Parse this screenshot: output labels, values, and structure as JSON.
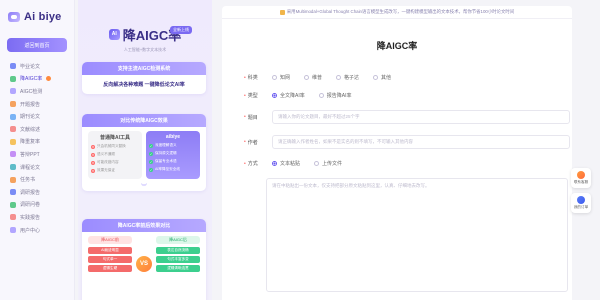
{
  "app": {
    "brand": "Ai biye"
  },
  "sidebar": {
    "home_button": "返回到首页",
    "items": [
      {
        "label": "毕业论文",
        "color": "#7a8cf5"
      },
      {
        "label": "降AIGC率",
        "color": "#5fc98b",
        "active": true,
        "badge": true
      },
      {
        "label": "AIGC检测",
        "color": "#b2a6ff"
      },
      {
        "label": "开题报告",
        "color": "#f5a25f"
      },
      {
        "label": "期刊论文",
        "color": "#7ab3f5"
      },
      {
        "label": "文献综述",
        "color": "#f58f8f"
      },
      {
        "label": "降重复率",
        "color": "#f5c25f"
      },
      {
        "label": "答辩PPT",
        "color": "#c48ff5"
      },
      {
        "label": "课程论文",
        "color": "#5fbcc9"
      },
      {
        "label": "任务书",
        "color": "#f5a25f"
      },
      {
        "label": "调研报告",
        "color": "#7a8cf5"
      },
      {
        "label": "调研问卷",
        "color": "#5fc98b"
      },
      {
        "label": "实践报告",
        "color": "#f58f8f"
      },
      {
        "label": "用户中心",
        "color": "#b2a6ff"
      }
    ]
  },
  "promo": {
    "ai_chip": "AI",
    "title": "降AIGC率",
    "tag": "全新上线",
    "subtitle": "人工智能+数字文本技术",
    "pill1": "支持主流AIGC检测系统",
    "card1_text": "反向解决各种难题 一键降低论文AI率",
    "card2_head": "对比传统降AIGC效果",
    "cmp_left_title": "普通降AI工具",
    "cmp_right_title": "aibiye",
    "cmp_left_rows": [
      "只会机械同义替换",
      "语义不通顺",
      "可能改错内容",
      "效果无保证"
    ],
    "cmp_right_rows": [
      "深度理解语义",
      "保持原文逻辑",
      "保留专业术语",
      "AI率降至安全线"
    ],
    "card3_head": "降AIGC率前后效果对比",
    "vs_left_head": "降AIGC前",
    "vs_right_head": "降AIGC后",
    "vs_left_items": [
      "AI痕迹明显",
      "句式单一",
      "逻辑生硬"
    ],
    "vs_right_items": [
      "表达自然流畅",
      "句式丰富多变",
      "逻辑清晰连贯"
    ],
    "vs_label": "VS"
  },
  "main": {
    "notice": "采用Multimodal+Global Thought Chain语言模型生成改写，一键构建模型输出的文本技术，帮你节省100小时论文时间",
    "title": "降AIGC率",
    "form": {
      "subject_label": "科类",
      "subject_options": [
        "知网",
        "维普",
        "格子达",
        "其他"
      ],
      "type_label": "类型",
      "type_options": [
        "全文降AI率",
        "报告降AI率"
      ],
      "title_label": "题目",
      "title_placeholder": "请输入你的论文题目，最好不超过25个字",
      "author_label": "作者",
      "author_placeholder": "请正确输入作者姓名，如果不是实名的则不填写，不可输入其他内容",
      "method_label": "方式",
      "method_options": [
        "文本粘贴",
        "上传文件"
      ],
      "text_placeholder": "请在中粘贴出一份文本，仅支持把部分原文粘贴到这里，认真、仔细地去改写。"
    }
  },
  "float": {
    "service_label": "联系客服",
    "history_label": "我的订单"
  }
}
